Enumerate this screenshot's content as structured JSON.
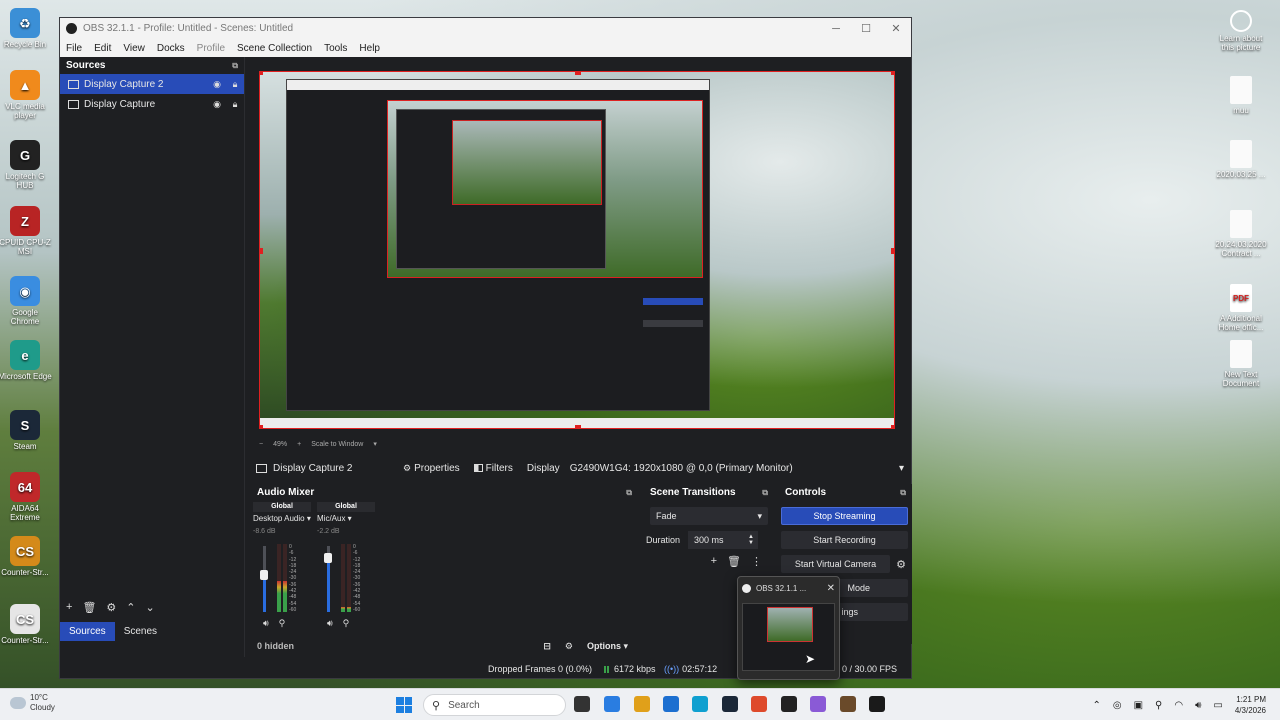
{
  "desktop": {
    "icons_left": [
      {
        "label": "Recycle Bin",
        "color": "#3b8fd6",
        "glyph": "♻"
      },
      {
        "label": "VLC media player",
        "color": "#f08a1c",
        "glyph": "▲"
      },
      {
        "label": "Logitech G HUB",
        "color": "#222222",
        "glyph": "G"
      },
      {
        "label": "CPUID CPU-Z MSI",
        "color": "#b82424",
        "glyph": "Z"
      },
      {
        "label": "Google Chrome",
        "color": "#3a8de0",
        "glyph": "◉"
      },
      {
        "label": "Microsoft Edge",
        "color": "#1f9b8a",
        "glyph": "e"
      },
      {
        "label": "Steam",
        "color": "#1b2838",
        "glyph": "S"
      },
      {
        "label": "AIDA64 Extreme",
        "color": "#c0282a",
        "glyph": "64"
      },
      {
        "label": "Counter-Str...",
        "color": "#d48a1a",
        "glyph": "CS"
      },
      {
        "label": "Counter-Str...",
        "color": "#e6e6e6",
        "glyph": "CS"
      }
    ],
    "icons_right": [
      {
        "label": "Learn about this picture",
        "kind": "camera"
      },
      {
        "label": "muu",
        "kind": "file"
      },
      {
        "label": "2020.03.25 ...",
        "kind": "file"
      },
      {
        "label": "20.24.03.2020 Contract ...",
        "kind": "file"
      },
      {
        "label": "A Additional Home offic...",
        "kind": "pdf"
      },
      {
        "label": "New Text Document",
        "kind": "file"
      }
    ]
  },
  "obs": {
    "window_title": "OBS 32.1.1 - Profile: Untitled - Scenes: Untitled",
    "menu": [
      "File",
      "Edit",
      "View",
      "Docks",
      "Profile",
      "Scene Collection",
      "Tools",
      "Help"
    ],
    "sources": {
      "title": "Sources",
      "items": [
        {
          "label": "Display Capture 2",
          "selected": true
        },
        {
          "label": "Display Capture",
          "selected": false
        }
      ],
      "tabs": [
        "Sources",
        "Scenes"
      ],
      "active_tab": "Sources"
    },
    "preview_bar": {
      "zoom": "49%",
      "scale_mode": "Scale to Window"
    },
    "source_toolbar": {
      "source_name": "Display Capture 2",
      "properties": "Properties",
      "filters": "Filters",
      "display_label": "Display",
      "display_value": "G2490W1G4: 1920x1080 @ 0,0 (Primary Monitor)"
    },
    "audio_mixer": {
      "title": "Audio Mixer",
      "channels": [
        {
          "global": "Global",
          "name": "Desktop Audio",
          "db": "-8.6 dB",
          "level": 0.55,
          "meter": 0.45
        },
        {
          "global": "Global",
          "name": "Mic/Aux",
          "db": "-2.2 dB",
          "level": 0.82,
          "meter": 0.08
        }
      ],
      "ticks": [
        "0",
        "-6",
        "-12",
        "-18",
        "-24",
        "-30",
        "-36",
        "-42",
        "-48",
        "-54",
        "-60"
      ],
      "hidden_label": "0 hidden",
      "options_label": "Options"
    },
    "scene_transitions": {
      "title": "Scene Transitions",
      "transition": "Fade",
      "duration_label": "Duration",
      "duration_value": "300 ms"
    },
    "controls": {
      "title": "Controls",
      "stop_streaming": "Stop Streaming",
      "start_recording": "Start Recording",
      "start_virtual_camera": "Start Virtual Camera",
      "studio_mode_partial": "Mode",
      "settings_partial": "ings"
    },
    "status": {
      "dropped_frames": "Dropped Frames 0 (0.0%)",
      "kbps": "6172 kbps",
      "timer": "02:57:12",
      "fps": "0 / 30.00 FPS"
    }
  },
  "thumbnail_popup": {
    "title": "OBS 32.1.1 ..."
  },
  "taskbar": {
    "weather_temp": "10°C",
    "weather_desc": "Cloudy",
    "search_placeholder": "Search",
    "time": "1:21 PM",
    "date": "4/3/2026",
    "app_colors": [
      "#333333",
      "#2a7de1",
      "#e0a01a",
      "#1c6fd0",
      "#0fa0d0",
      "#1b2838",
      "#de4a2b",
      "#222222",
      "#8a5ad6",
      "#6a4a2a",
      "#1a1a1a"
    ]
  },
  "colors": {
    "accent": "#284cb8",
    "preview_border": "#e02020"
  }
}
